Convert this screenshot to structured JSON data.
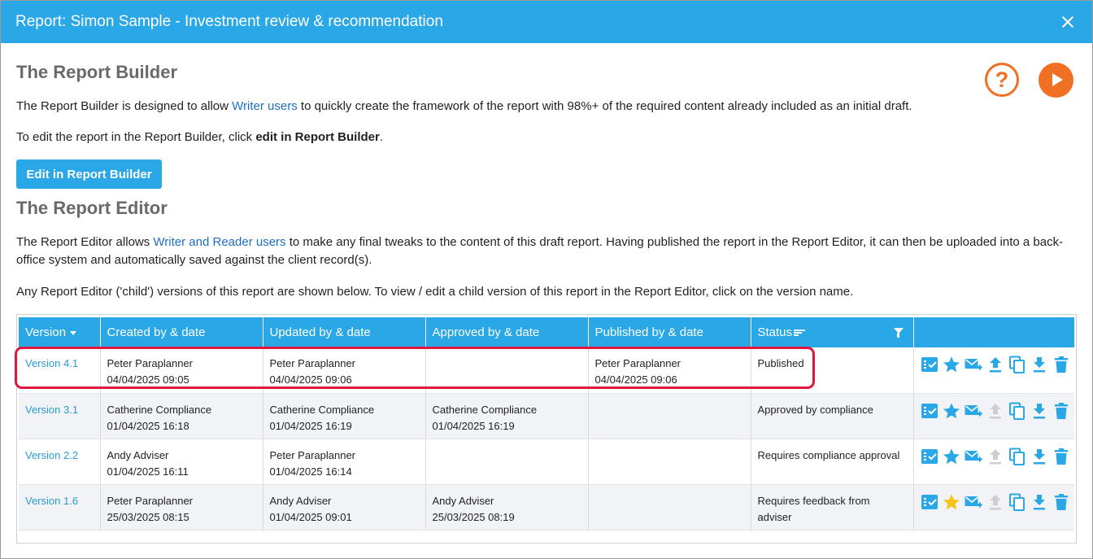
{
  "window": {
    "title": "Report: Simon Sample - Investment review & recommendation"
  },
  "builder": {
    "heading": "The Report Builder",
    "intro_before": "The Report Builder is designed to allow ",
    "intro_link": "Writer users",
    "intro_after": " to quickly create the framework of the report with 98%+ of the required content already included as an initial draft.",
    "edit_before": "To edit the report in the Report Builder, click ",
    "edit_bold": "edit in Report Builder",
    "edit_after": ".",
    "button_label": "Edit in Report Builder"
  },
  "editor": {
    "heading": "The Report Editor",
    "intro_before": "The Report Editor allows ",
    "intro_link": "Writer and Reader users",
    "intro_after": " to make any final tweaks to the content of this draft report. Having published the report in the Report Editor, it can then be uploaded into a back-office system and automatically saved against the client record(s).",
    "child_note": "Any Report Editor ('child') versions of this report are shown below. To view / edit a child version of this report in the Report Editor, click on the version name."
  },
  "help_icon_glyph": "?",
  "table": {
    "headers": [
      "Version",
      "Created by & date",
      "Updated by & date",
      "Approved by & date",
      "Published by & date",
      "Status",
      ""
    ],
    "rows": [
      {
        "version": "Version 4.1",
        "created_by": "Peter Paraplanner",
        "created_date": "04/04/2025 09:05",
        "updated_by": "Peter Paraplanner",
        "updated_date": "04/04/2025 09:06",
        "approved_by": "",
        "approved_date": "",
        "published_by": "Peter Paraplanner",
        "published_date": "04/04/2025 09:06",
        "status": "Published",
        "star_color": "#2aa7e6",
        "upload_enabled": true
      },
      {
        "version": "Version 3.1",
        "created_by": "Catherine Compliance",
        "created_date": "01/04/2025 16:18",
        "updated_by": "Catherine Compliance",
        "updated_date": "01/04/2025 16:19",
        "approved_by": "Catherine Compliance",
        "approved_date": "01/04/2025 16:19",
        "published_by": "",
        "published_date": "",
        "status": "Approved by compliance",
        "star_color": "#2aa7e6",
        "upload_enabled": false
      },
      {
        "version": "Version 2.2",
        "created_by": "Andy Adviser",
        "created_date": "01/04/2025 16:11",
        "updated_by": "Peter Paraplanner",
        "updated_date": "01/04/2025 16:14",
        "approved_by": "",
        "approved_date": "",
        "published_by": "",
        "published_date": "",
        "status": "Requires compliance approval",
        "star_color": "#2aa7e6",
        "upload_enabled": false
      },
      {
        "version": "Version 1.6",
        "created_by": "Peter Paraplanner",
        "created_date": "25/03/2025 08:15",
        "updated_by": "Andy Adviser",
        "updated_date": "01/04/2025 09:01",
        "approved_by": "Andy Adviser",
        "approved_date": "25/03/2025 08:19",
        "published_by": "",
        "published_date": "",
        "status": "Requires feedback from adviser",
        "star_color": "#f5c518",
        "upload_enabled": false
      }
    ]
  },
  "colors": {
    "accent": "#2aa7e6",
    "orange": "#f07024",
    "highlight": "#e0163c",
    "disabled_icon": "#cfcfcf"
  },
  "row_action_icons": [
    "checklist-icon",
    "star-icon",
    "send-email-icon",
    "upload-icon",
    "copy-icon",
    "download-icon",
    "delete-icon"
  ]
}
